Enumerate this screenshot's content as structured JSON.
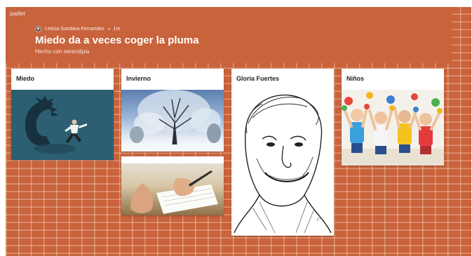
{
  "app": {
    "brand": "padlet"
  },
  "header": {
    "author": "Leticia Gandara Fernandez",
    "separator": "•",
    "time": "1m",
    "title": "Miedo da a veces coger la pluma",
    "subtitle": "Hecho con serendipia"
  },
  "cards": [
    {
      "title": "Miedo",
      "image": "fear-shadow-illustration"
    },
    {
      "title": "Invierno",
      "image": "snowy-winter-tree-photo"
    },
    {
      "title": "",
      "image": "hand-writing-in-notebook-photo"
    },
    {
      "title": "Gloria Fuertes",
      "image": "gloria-fuertes-pencil-portrait"
    },
    {
      "title": "Niños",
      "image": "children-with-painted-hands-photo"
    }
  ],
  "colors": {
    "background": "#c9633c",
    "card": "#ffffff",
    "fear_panel": "#2c5f72"
  }
}
